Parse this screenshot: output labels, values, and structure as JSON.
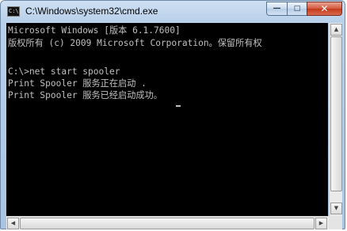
{
  "window": {
    "title": "C:\\Windows\\system32\\cmd.exe",
    "icon": "cmd-icon",
    "icon_label": "C:\\",
    "controls": {
      "minimize": "—",
      "maximize": "□",
      "close": "✕"
    }
  },
  "console": {
    "lines": [
      "Microsoft Windows [版本 6.1.7600]",
      "版权所有 (c) 2009 Microsoft Corporation。保留所有权",
      "",
      "C:\\>net start spooler",
      "Print Spooler 服务正在启动 .",
      "Print Spooler 服务已经启动成功。"
    ],
    "text_color": "#c0c0c0",
    "background": "#000000"
  },
  "scrollbars": {
    "up": "▲",
    "down": "▼",
    "left": "◀",
    "right": "▶"
  }
}
